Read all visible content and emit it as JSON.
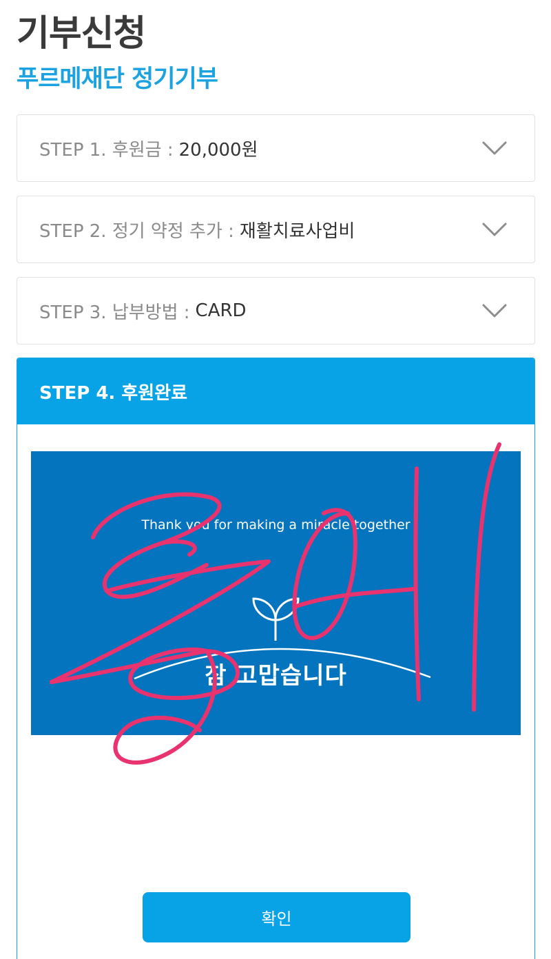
{
  "header": {
    "title": "기부신청",
    "subtitle": "푸르메재단 정기기부"
  },
  "steps": [
    {
      "label": "STEP 1. 후원금 :",
      "value": "20,000원"
    },
    {
      "label": "STEP 2. 정기 약정 추가 :",
      "value": "재활치료사업비"
    },
    {
      "label": "STEP 3. 납부방법 :",
      "value": "CARD"
    }
  ],
  "step4": {
    "title": "STEP 4. 후원완료",
    "banner": {
      "tagline": "Thank you for making a miracle together",
      "message": "참 고맙습니다"
    },
    "confirm_label": "확인"
  },
  "colors": {
    "accent": "#08a3e6",
    "banner_bg": "#0474be",
    "scribble": "#e8336e"
  },
  "annotation": {
    "type": "handwritten-scribble",
    "text": "롤캐"
  }
}
